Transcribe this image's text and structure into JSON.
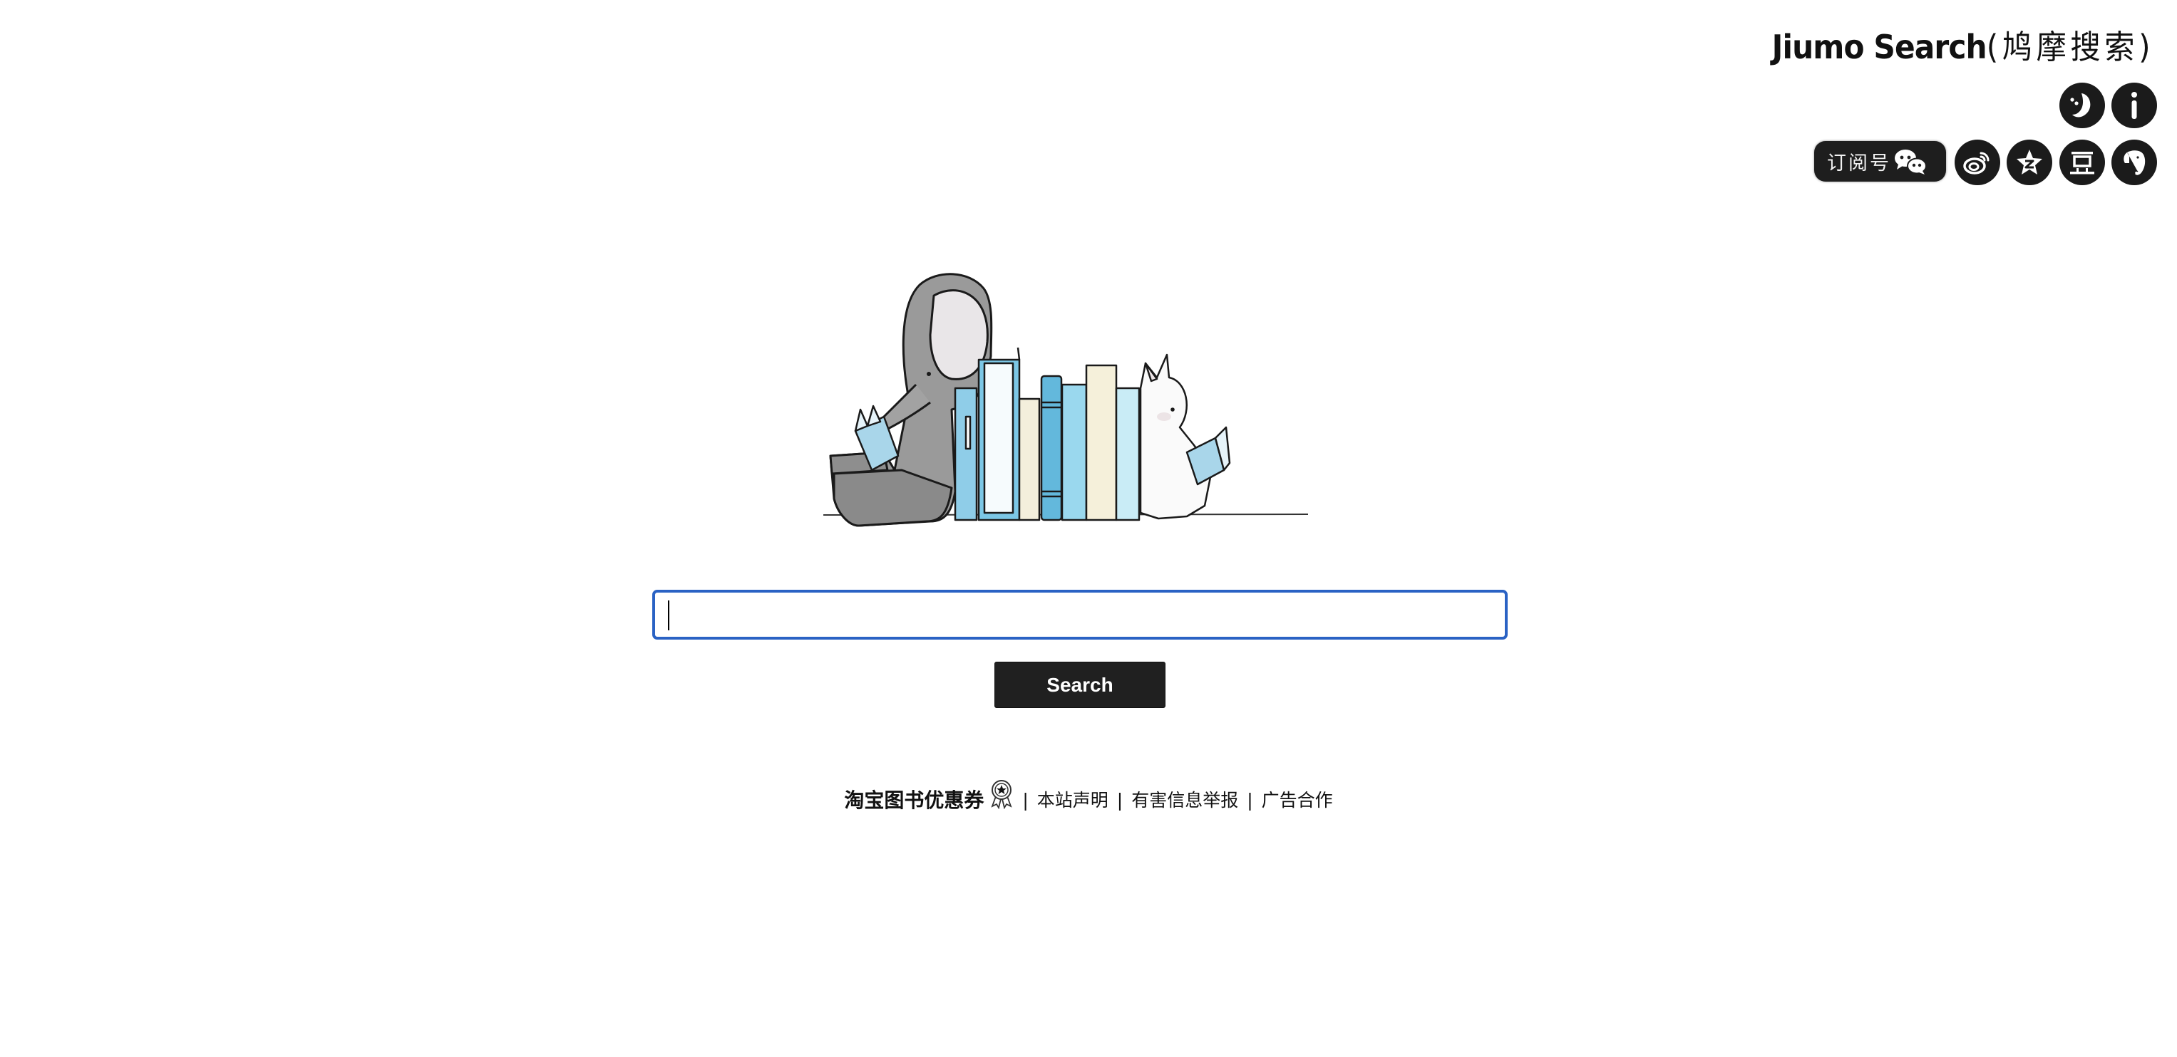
{
  "header": {
    "title_en": "Jiumo Search",
    "title_cn": "(鸠摩搜索)",
    "top_icons": [
      {
        "name": "moon-icon",
        "label": "Night mode"
      },
      {
        "name": "info-icon",
        "label": "About"
      }
    ],
    "subscription": {
      "label": "订阅号",
      "icon": "wechat-icon"
    },
    "social_icons": [
      {
        "name": "weibo-icon"
      },
      {
        "name": "qzone-icon"
      },
      {
        "name": "douban-icon",
        "glyph": "豆"
      },
      {
        "name": "evernote-icon"
      }
    ]
  },
  "search": {
    "value": "",
    "placeholder": "",
    "button_label": "Search"
  },
  "footer": {
    "promo_label": "淘宝图书优惠券",
    "promo_icon": "award-badge-icon",
    "separator": "|",
    "links": [
      {
        "label": "本站声明"
      },
      {
        "label": "有害信息举报"
      },
      {
        "label": "广告合作"
      }
    ]
  },
  "colors": {
    "accent_border": "#2a62c4",
    "button_bg": "#202020",
    "icon_bg": "#1b1b1b"
  }
}
